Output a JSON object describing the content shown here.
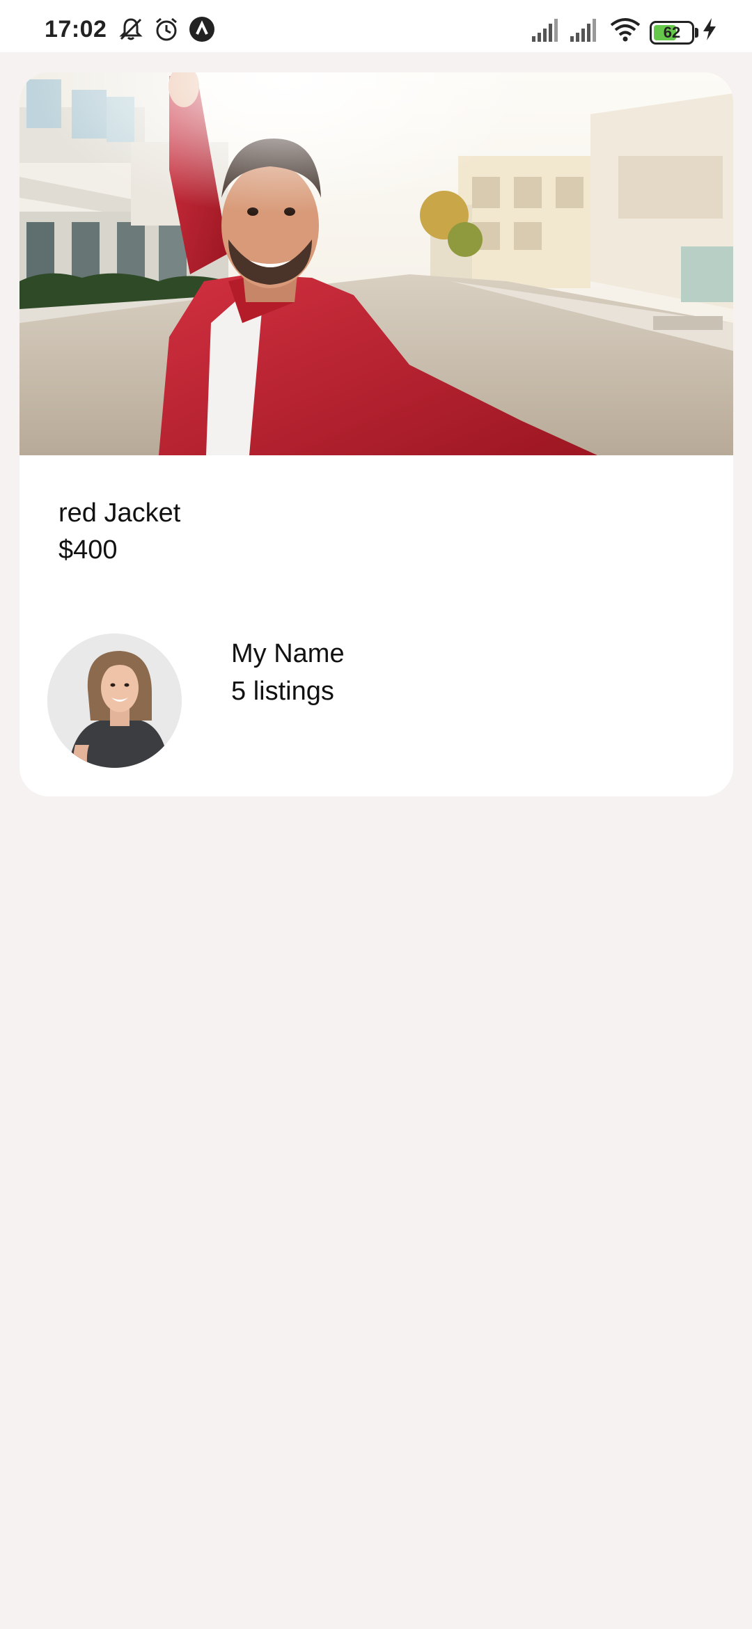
{
  "status_bar": {
    "time": "17:02",
    "battery_level": "62",
    "icons": [
      "notifications-muted-icon",
      "alarm-icon",
      "app-notification-icon",
      "signal-icon",
      "signal-icon",
      "wifi-icon",
      "battery-icon",
      "charging-icon"
    ]
  },
  "listing": {
    "title": "red Jacket",
    "price": "$400",
    "image": "hero-photo"
  },
  "seller": {
    "name": "My Name",
    "listings": "5 listings",
    "avatar": "avatar-photo"
  },
  "colors": {
    "background": "#f6f2f1",
    "card": "#ffffff",
    "jacket": "#b81d2a",
    "battery": "#66c84a"
  }
}
